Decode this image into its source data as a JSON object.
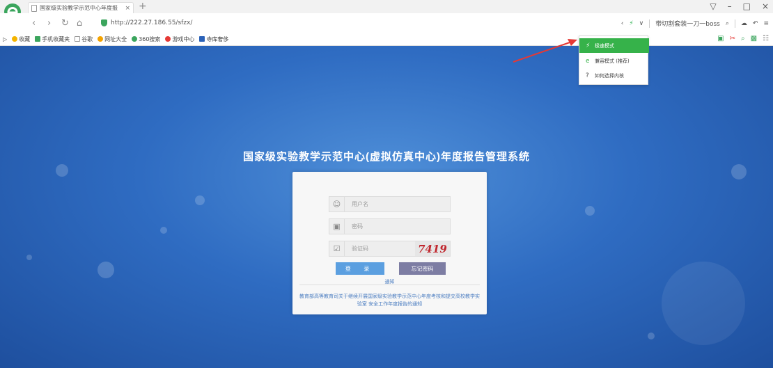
{
  "browser": {
    "tab_title": "国家级实验教学示范中心年度报",
    "new_tab": "+",
    "tab_close": "×",
    "window_controls": [
      "▽",
      "–",
      "□",
      "×"
    ],
    "url": "http://222.27.186.55/sfzx/",
    "right_text": "带切割套装一刀一boss"
  },
  "bookmarks": [
    {
      "label": "收藏",
      "color": "#f4b400"
    },
    {
      "label": "手机收藏夹",
      "color": "#3ba55d"
    },
    {
      "label": "谷歌",
      "color": "#999999"
    },
    {
      "label": "网址大全",
      "color": "#f4a300"
    },
    {
      "label": "360搜索",
      "color": "#3ba55d"
    },
    {
      "label": "游戏中心",
      "color": "#e53935"
    },
    {
      "label": "寺库奢侈",
      "color": "#2b62b8"
    }
  ],
  "page": {
    "system_title": "国家级实验教学示范中心(虚拟仿真中心)年度报告管理系统",
    "username_placeholder": "用户名",
    "password_placeholder": "密码",
    "captcha_placeholder": "验证码",
    "captcha_text": "7419",
    "login_button": "登 录",
    "forget_button": "忘记密码",
    "notice_title": "通知",
    "notice_text": "教育部高等教育司关于继续开展国家级实验教学示范中心年度考核和提交高校教学实验室 安全工作年度报告的通知"
  },
  "mode_menu": {
    "items": [
      {
        "label": "极速模式",
        "icon": "lightning-icon",
        "active": true
      },
      {
        "label": "兼容模式 (推荐)",
        "icon": "ie-icon",
        "active": false
      },
      {
        "label": "如何选择内核",
        "icon": "help-icon",
        "active": false
      }
    ]
  },
  "colors": {
    "accent_green": "#36b24a",
    "page_blue": "#2f6cc2",
    "arrow_red": "#e53935"
  }
}
